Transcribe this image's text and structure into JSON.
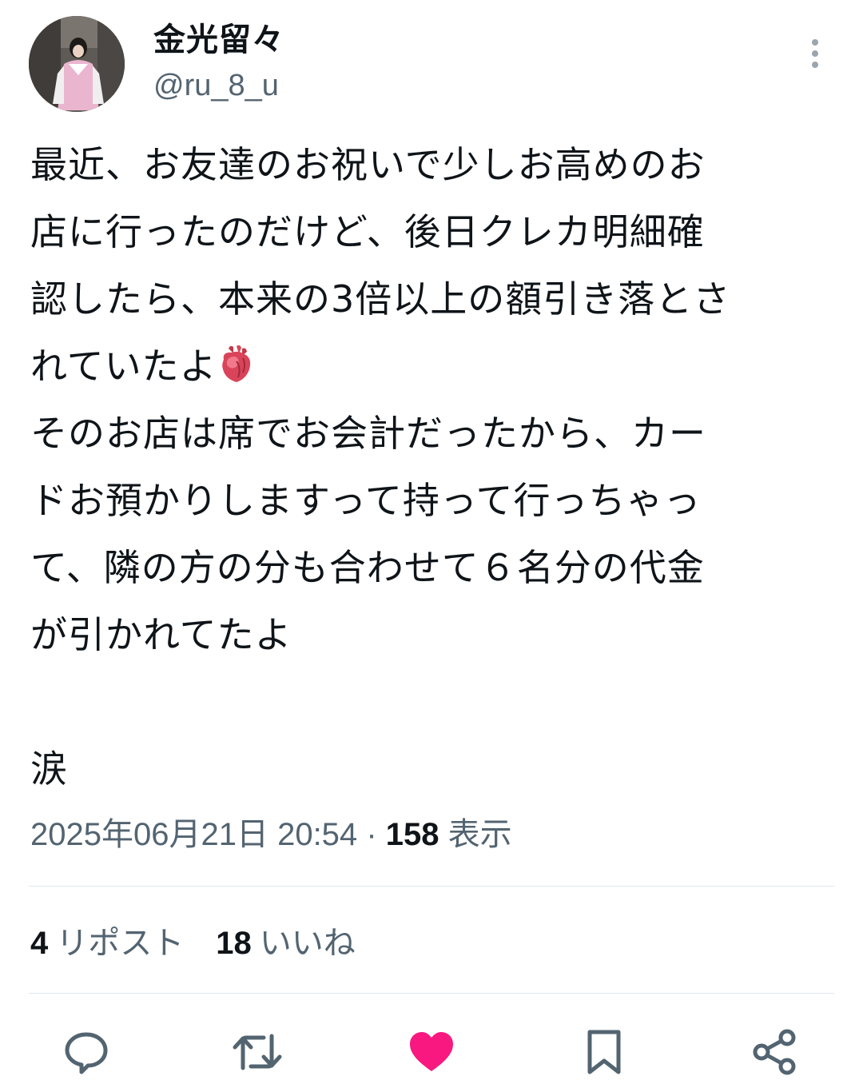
{
  "author": {
    "display_name": "金光留々",
    "handle": "@ru_8_u"
  },
  "post": {
    "lines": [
      "最近、お友達のお祝いで少しお高めのお",
      "店に行ったのだけど、後日クレカ明細確",
      "認したら、本来の3倍以上の額引き落とさ",
      "れていたよ",
      "そのお店は席でお会計だったから、カー",
      "ドお預かりしますって持って行っちゃっ",
      "て、隣の方の分も合わせて６名分の代金",
      "が引かれてたよ",
      "",
      "涙"
    ],
    "emoji_after_line_4": "anatomical-heart"
  },
  "meta": {
    "timestamp": "2025年06月21日 20:54",
    "separator": "·",
    "views_count": "158",
    "views_label": "表示"
  },
  "stats": {
    "reposts_count": "4",
    "reposts_label": "リポスト",
    "likes_count": "18",
    "likes_label": "いいね"
  },
  "actions": {
    "reply_icon": "speech-bubble-icon",
    "repost_icon": "repost-arrows-icon",
    "like_icon": "filled-heart-icon",
    "bookmark_icon": "bookmark-icon",
    "share_icon": "share-nodes-icon"
  },
  "colors": {
    "text_primary": "#0f1419",
    "text_secondary": "#536471",
    "like_active": "#f91880",
    "icon_default": "#536471",
    "divider": "#e1e8ed"
  }
}
